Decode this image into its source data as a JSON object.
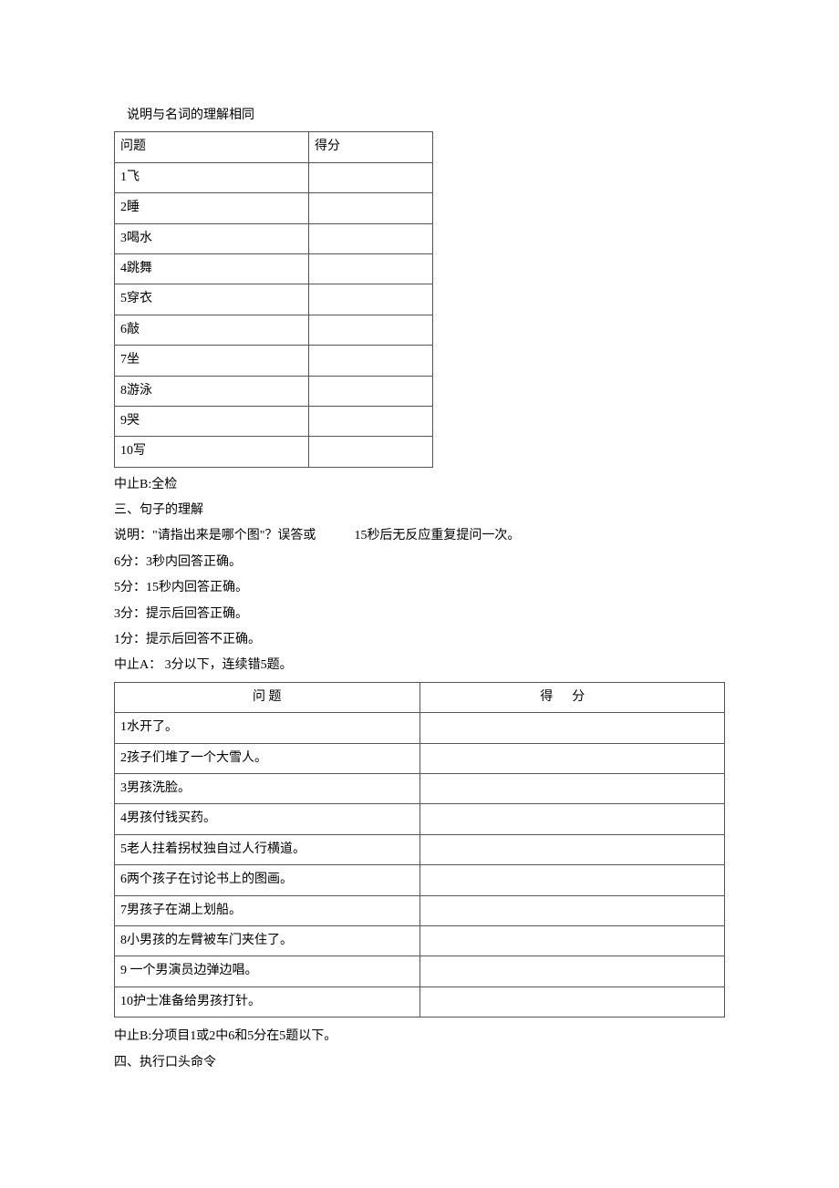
{
  "heading1": "说明与名词的理解相同",
  "table1": {
    "headers": [
      "问题",
      "得分"
    ],
    "rows": [
      "1飞",
      "2睡",
      "3喝水",
      "4跳舞",
      "5穿衣",
      "6敲",
      "7坐",
      "8游泳",
      "9哭",
      "10写"
    ]
  },
  "p1": "中止B:全检",
  "p2": "三、句子的理解",
  "p3_a": "说明：\"请指出来是哪个图\"？误答或",
  "p3_b": "15秒后无反应重复提问一次。",
  "p4": "6分：3秒内回答正确。",
  "p5": "5分：15秒内回答正确。",
  "p6": "3分：提示后回答正确。",
  "p7": "1分：提示后回答不正确。",
  "p8": "中止A： 3分以下，连续错5题。",
  "table2": {
    "headers": [
      "问 题",
      "得分"
    ],
    "rows": [
      "1水开了。",
      "2孩子们堆了一个大雪人。",
      "3男孩洗脸。",
      "4男孩付钱买药。",
      "5老人拄着拐杖独自过人行横道。",
      "6两个孩子在讨论书上的图画。",
      "7男孩子在湖上划船。",
      "8小男孩的左臂被车门夹住了。",
      "9 一个男演员边弹边唱。",
      "10护士准备给男孩打针。"
    ]
  },
  "p9": "中止B:分项目1或2中6和5分在5题以下。",
  "p10": "四、执行口头命令"
}
